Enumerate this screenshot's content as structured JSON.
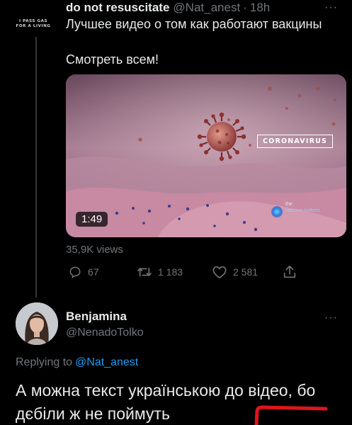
{
  "tweet": {
    "avatar_lines": [
      "I PASS GAS",
      "FOR A LIVING"
    ],
    "name": "do not resuscitate",
    "handle": "@Nat_anest",
    "separator": "·",
    "time": "18h",
    "more": "···",
    "text_line1": "Лучшее видео о том как работают вакцины",
    "text_line2": "Смотреть всем!",
    "video": {
      "label": "CORONAVIRUS",
      "duration": "1:49",
      "logo_line1": "the",
      "logo_line2": "vaccine makers",
      "tint": "#9d6f84"
    },
    "views": "35,9K views",
    "actions": {
      "reply_count": "67",
      "retweet_count": "1 183",
      "like_count": "2 581"
    }
  },
  "reply": {
    "name": "Benjamina",
    "handle": "@NenadoTolko",
    "more": "···",
    "replying_to_label": "Replying to",
    "replying_to_handle": "@Nat_anest",
    "text": "А можна текст українською до відео, бо дєбіли ж не поймуть"
  },
  "colors": {
    "background": "#000000",
    "text": "#e7e9ea",
    "muted": "#71767b",
    "accent": "#1d9bf0",
    "annotation": "#e0141e"
  },
  "icons": [
    "reply-icon",
    "retweet-icon",
    "like-icon",
    "share-icon"
  ]
}
